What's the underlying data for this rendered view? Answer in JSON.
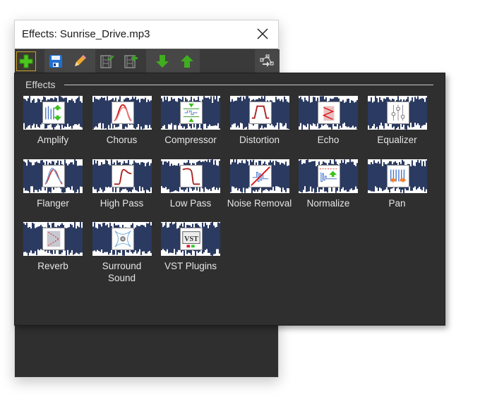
{
  "window": {
    "title": "Effects: Sunrise_Drive.mp3",
    "close_icon": "close-x-icon"
  },
  "toolbar": {
    "buttons": [
      {
        "name": "add-effect",
        "icon": "green-plus-icon",
        "active": true
      },
      {
        "name": "save",
        "icon": "floppy-disk-icon"
      },
      {
        "name": "edit",
        "icon": "pencil-icon"
      },
      {
        "name": "apply-to-clip",
        "icon": "film-check-icon"
      },
      {
        "name": "add-to-clip",
        "icon": "film-plus-icon"
      },
      {
        "name": "move-down",
        "icon": "green-down-arrow-icon"
      },
      {
        "name": "move-up",
        "icon": "green-up-arrow-icon"
      },
      {
        "name": "effect-chain",
        "icon": "node-graph-icon"
      }
    ]
  },
  "effects_panel": {
    "group_label": "Effects",
    "items": [
      {
        "label": "Amplify",
        "icon": "amplify-icon"
      },
      {
        "label": "Chorus",
        "icon": "chorus-icon"
      },
      {
        "label": "Compressor",
        "icon": "compressor-icon"
      },
      {
        "label": "Distortion",
        "icon": "distortion-icon"
      },
      {
        "label": "Echo",
        "icon": "echo-icon"
      },
      {
        "label": "Equalizer",
        "icon": "equalizer-icon"
      },
      {
        "label": "Flanger",
        "icon": "flanger-icon"
      },
      {
        "label": "High Pass",
        "icon": "high-pass-icon"
      },
      {
        "label": "Low Pass",
        "icon": "low-pass-icon"
      },
      {
        "label": "Noise Removal",
        "icon": "noise-removal-icon"
      },
      {
        "label": "Normalize",
        "icon": "normalize-icon"
      },
      {
        "label": "Pan",
        "icon": "pan-icon"
      },
      {
        "label": "Reverb",
        "icon": "reverb-icon"
      },
      {
        "label": "Surround Sound",
        "icon": "surround-sound-icon"
      },
      {
        "label": "VST Plugins",
        "icon": "vst-plugins-icon"
      }
    ]
  },
  "colors": {
    "panel_bg": "#2f2f2f",
    "toolbar_bg": "#3a3a3a",
    "waveform": "#2b3a60",
    "accent_green": "#4cc61e",
    "active_border": "#c9a227",
    "label_text": "#e6e6e6"
  }
}
